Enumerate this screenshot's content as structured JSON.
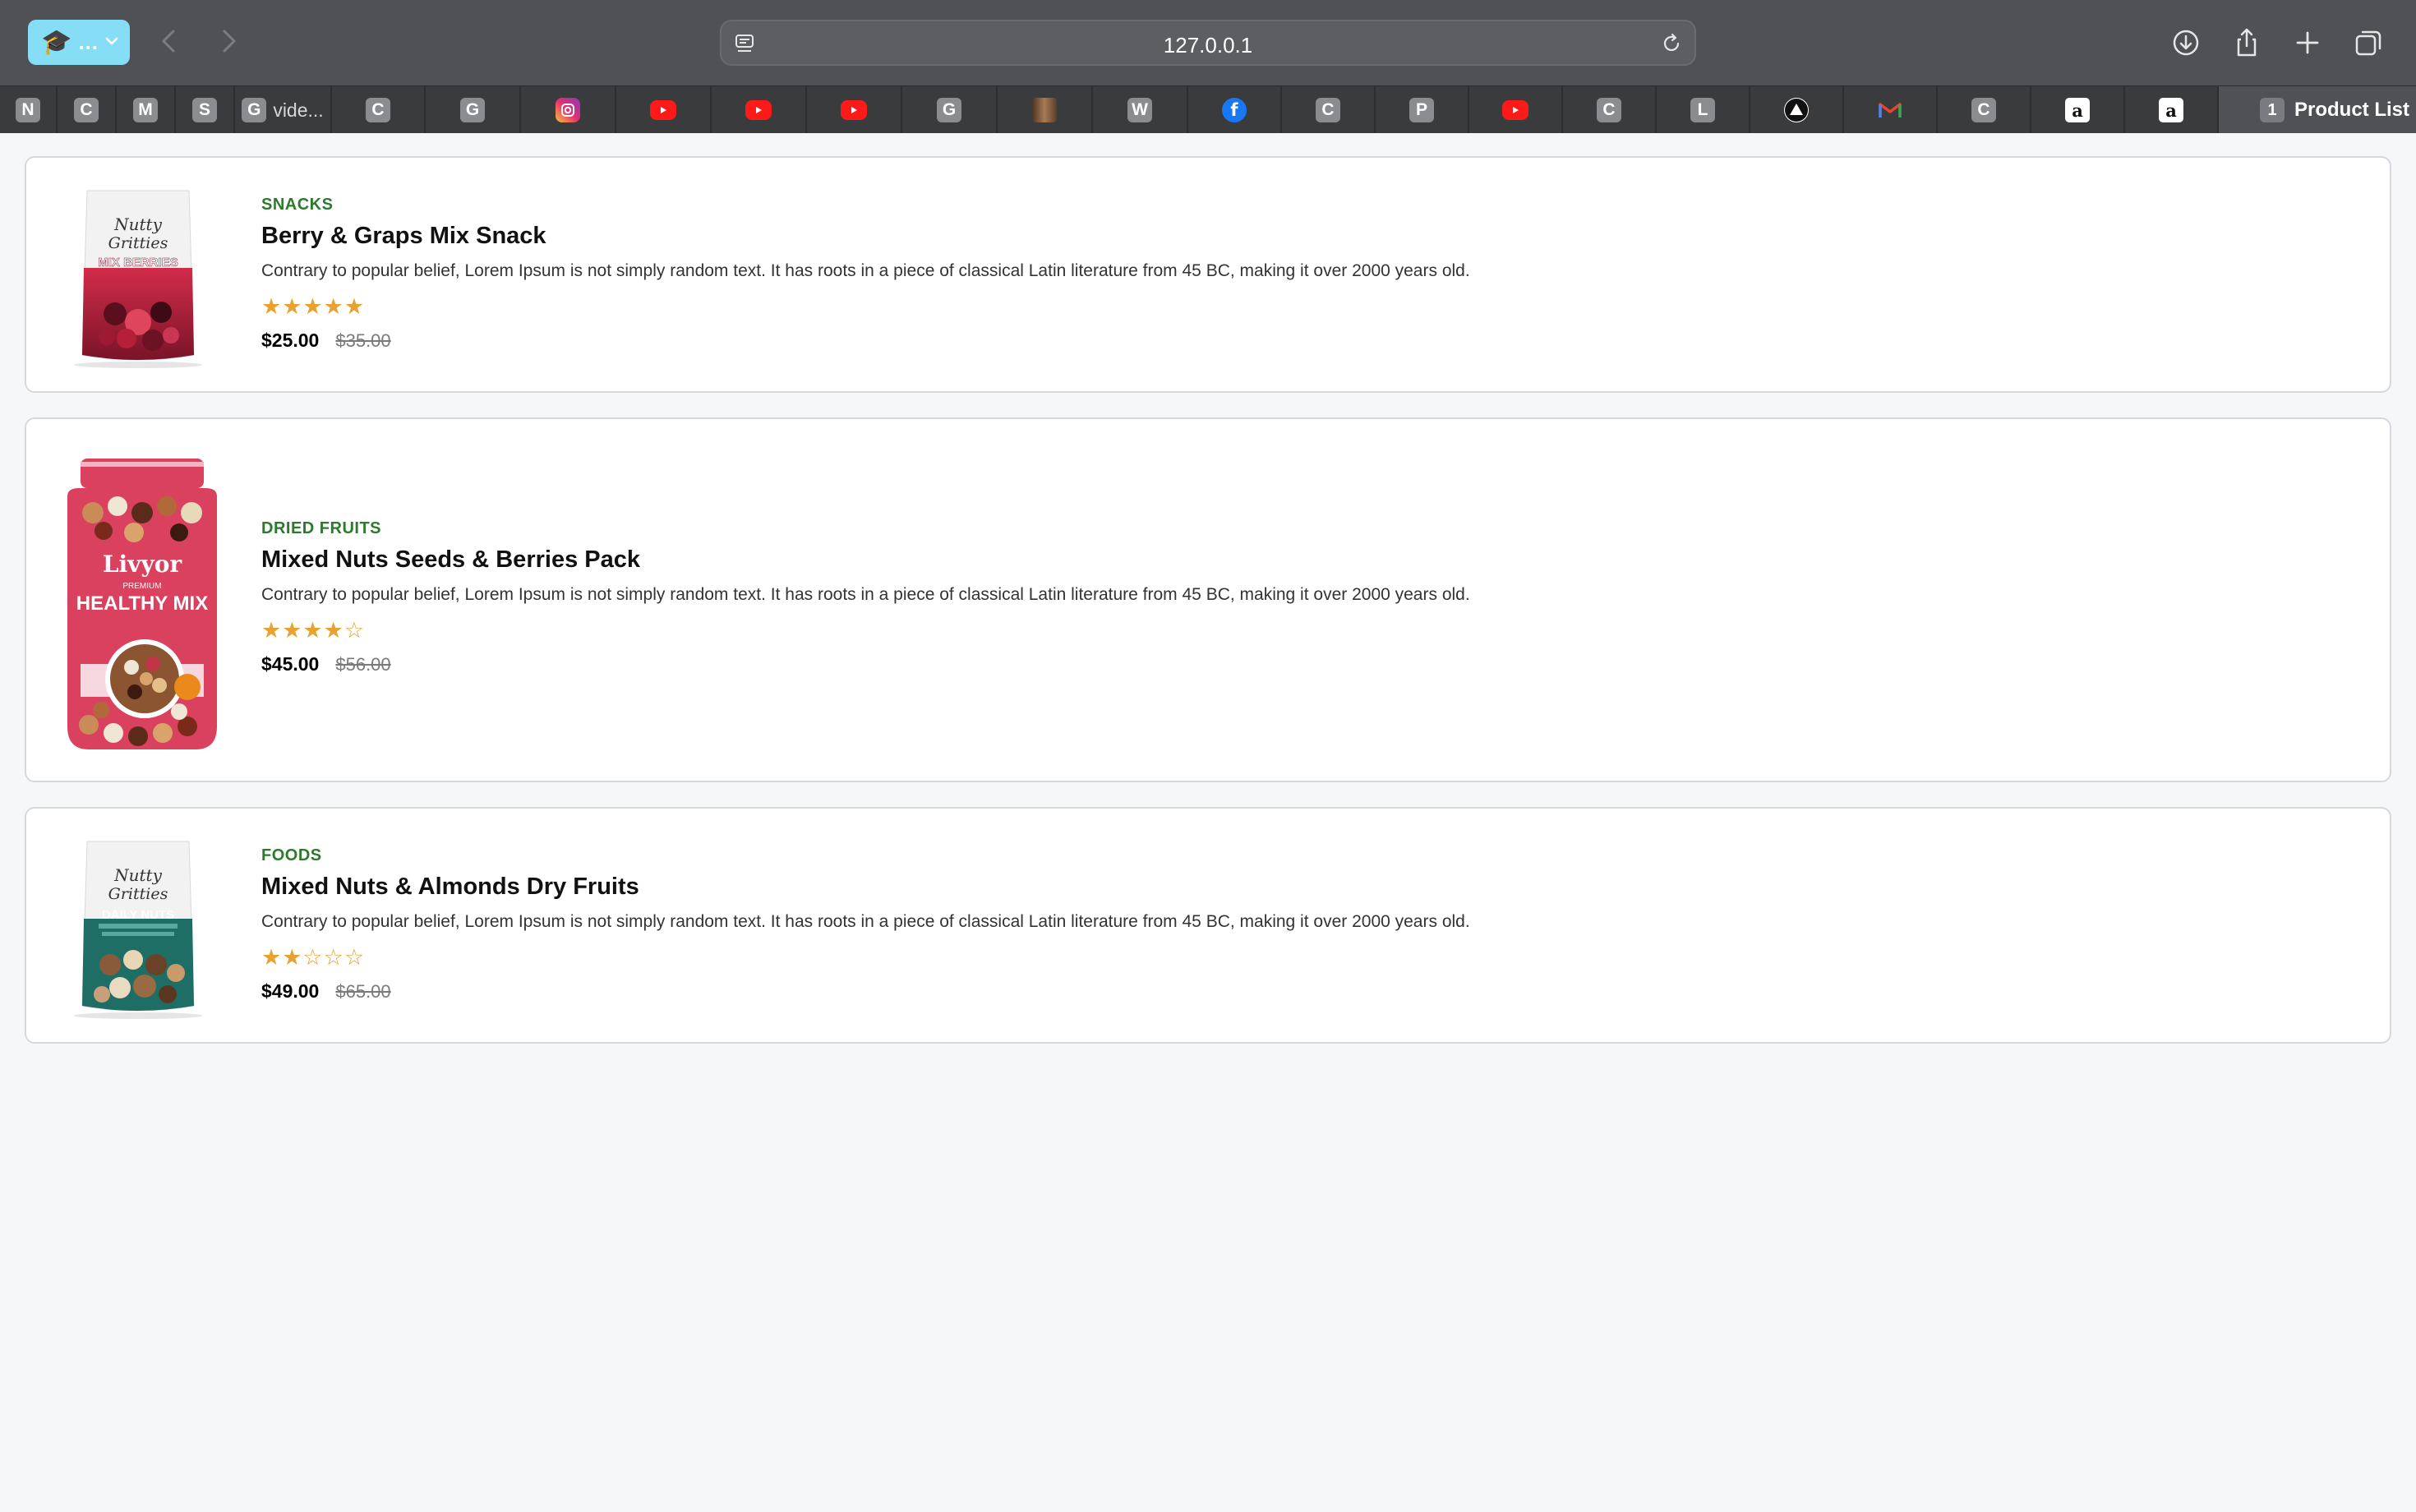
{
  "browser": {
    "url": "127.0.0.1",
    "profile_label": "...",
    "tabs": [
      {
        "icon": "N"
      },
      {
        "icon": "C"
      },
      {
        "icon": "M"
      },
      {
        "icon": "S"
      },
      {
        "icon": "G",
        "label": "vide..."
      },
      {
        "icon": "C"
      },
      {
        "icon": "G"
      },
      {
        "icon": "instagram-icon"
      },
      {
        "icon": "youtube-icon"
      },
      {
        "icon": "youtube-icon"
      },
      {
        "icon": "youtube-icon"
      },
      {
        "icon": "G"
      },
      {
        "icon": "photo-icon"
      },
      {
        "icon": "W"
      },
      {
        "icon": "facebook-icon"
      },
      {
        "icon": "C"
      },
      {
        "icon": "P"
      },
      {
        "icon": "youtube-icon"
      },
      {
        "icon": "C"
      },
      {
        "icon": "L"
      },
      {
        "icon": "triangle-icon"
      },
      {
        "icon": "gmail-icon"
      },
      {
        "icon": "C"
      },
      {
        "icon": "amazon-icon"
      },
      {
        "icon": "amazon-icon"
      }
    ],
    "active_tab": {
      "icon": "1",
      "title": "Product List"
    }
  },
  "products": [
    {
      "category": "SNACKS",
      "name": "Berry & Graps Mix Snack",
      "description": "Contrary to popular belief, Lorem Ipsum is not simply random text. It has roots in a piece of classical Latin literature from 45 BC, making it over 2000 years old.",
      "rating": 5,
      "stars": "★★★★★",
      "price": "$25.00",
      "old_price": "$35.00",
      "image": {
        "brand": "Nutty",
        "brand2": "Gritties",
        "label": "MIX BERRIES",
        "color": "#b8243f"
      }
    },
    {
      "category": "DRIED FRUITS",
      "name": "Mixed Nuts Seeds & Berries Pack",
      "description": "Contrary to popular belief, Lorem Ipsum is not simply random text. It has roots in a piece of classical Latin literature from 45 BC, making it over 2000 years old.",
      "rating": 4,
      "stars": "★★★★☆",
      "price": "$45.00",
      "old_price": "$56.00",
      "image": {
        "brand": "Livyor",
        "tag": "PREMIUM",
        "label": "HEALTHY MIX",
        "color": "#d9415e"
      }
    },
    {
      "category": "FOODS",
      "name": "Mixed Nuts & Almonds Dry Fruits",
      "description": "Contrary to popular belief, Lorem Ipsum is not simply random text. It has roots in a piece of classical Latin literature from 45 BC, making it over 2000 years old.",
      "rating": 2,
      "stars": "★★☆☆☆",
      "price": "$49.00",
      "old_price": "$65.00",
      "image": {
        "brand": "Nutty",
        "brand2": "Gritties",
        "label": "DAILY NUTS",
        "color": "#1f6e66"
      }
    }
  ]
}
